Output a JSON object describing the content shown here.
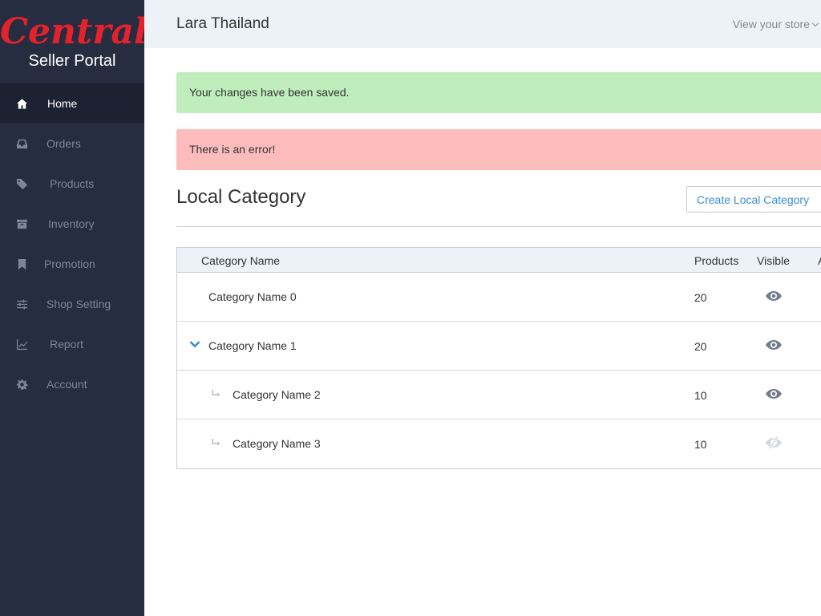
{
  "logo": {
    "brand": "Central",
    "subtitle": "Seller Portal"
  },
  "sidebar": {
    "items": [
      {
        "label": "Home",
        "icon": "home-icon",
        "active": true
      },
      {
        "label": "Orders",
        "icon": "inbox-icon"
      },
      {
        "label": "Products",
        "icon": "tag-icon"
      },
      {
        "label": "Inventory",
        "icon": "archive-icon"
      },
      {
        "label": "Promotion",
        "icon": "bookmark-icon"
      },
      {
        "label": "Shop Setting",
        "icon": "sliders-icon"
      },
      {
        "label": "Report",
        "icon": "line-chart-icon"
      },
      {
        "label": "Account",
        "icon": "gear-icon"
      }
    ]
  },
  "header": {
    "store_name": "Lara Thailand",
    "view_store": "View your store"
  },
  "alerts": {
    "success": "Your changes have been saved.",
    "error": "There is an error!"
  },
  "page": {
    "title": "Local Category",
    "create_button": "Create Local Category"
  },
  "table": {
    "headers": {
      "name": "Category Name",
      "products": "Products",
      "visible": "Visible",
      "extra": "A"
    },
    "rows": [
      {
        "name": "Category Name 0",
        "products": "20",
        "visible": true,
        "level": 0,
        "expanded": false
      },
      {
        "name": "Category Name 1",
        "products": "20",
        "visible": true,
        "level": 0,
        "expanded": true
      },
      {
        "name": "Category Name 2",
        "products": "10",
        "visible": true,
        "level": 1
      },
      {
        "name": "Category Name 3",
        "products": "10",
        "visible": false,
        "level": 1
      }
    ]
  },
  "colors": {
    "brand_red": "#e4222b",
    "sidebar_bg": "#262d40",
    "link_blue": "#3b8fd3",
    "success_bg": "#bfedbc",
    "error_bg": "#fdbcbc"
  }
}
